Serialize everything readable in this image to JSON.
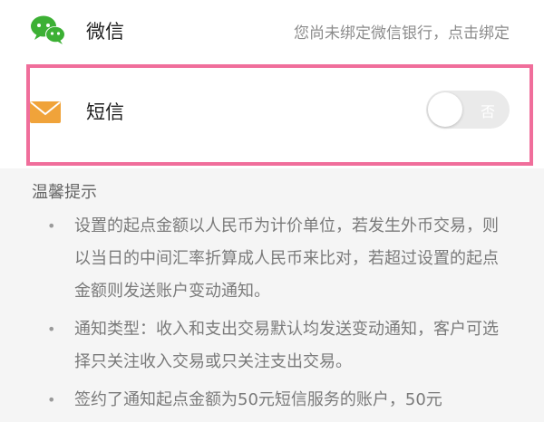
{
  "wechat_row": {
    "icon": "wechat-icon",
    "label": "微信",
    "hint": "您尚未绑定微信银行，点击绑定"
  },
  "sms_row": {
    "icon": "envelope-icon",
    "label": "短信",
    "toggle_text": "否",
    "toggle_on": false
  },
  "tips": {
    "title": "温馨提示",
    "items": [
      "设置的起点金额以人民币为计价单位，若发生外币交易，则以当日的中间汇率折算成人民币来比对，若超过设置的起点金额则发送账户变动通知。",
      "通知类型：收入和支出交易默认均发送变动通知，客户可选择只关注收入交易或只关注支出交易。",
      "签约了通知起点金额为50元短信服务的账户，50元"
    ]
  },
  "colors": {
    "highlight_border": "#f06e9b",
    "wechat_green": "#3cb034",
    "envelope_orange": "#f0a33a"
  }
}
